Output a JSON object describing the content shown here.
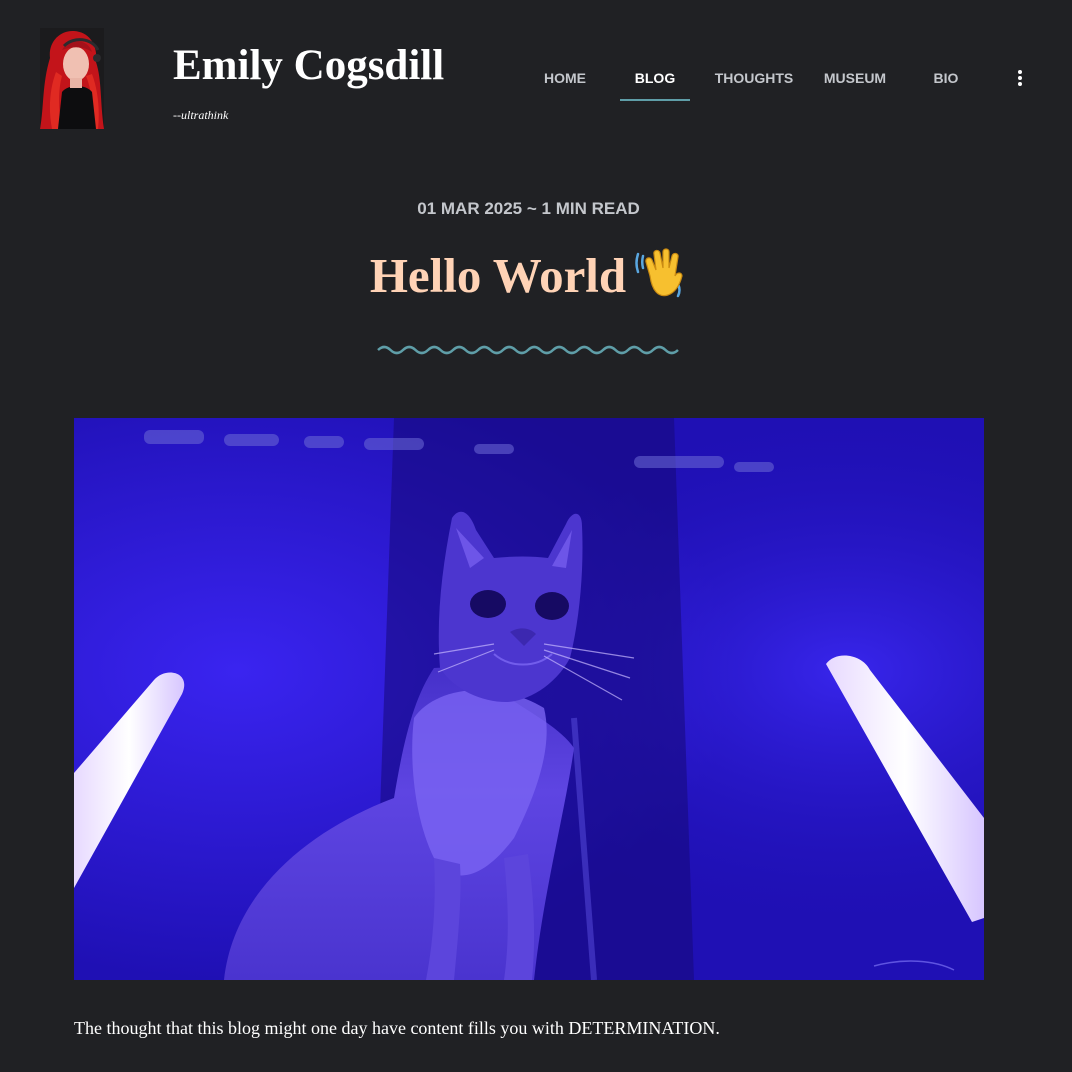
{
  "site": {
    "title": "Emily Cogsdill",
    "tagline": "--ultrathink"
  },
  "nav": {
    "items": [
      {
        "label": "HOME",
        "active": false
      },
      {
        "label": "BLOG",
        "active": true
      },
      {
        "label": "THOUGHTS",
        "active": false
      },
      {
        "label": "MUSEUM",
        "active": false
      },
      {
        "label": "BIO",
        "active": false
      }
    ],
    "more_icon": "kebab-menu-icon"
  },
  "post": {
    "meta": "01 MAR 2025 ~ 1 MIN READ",
    "title": "Hello World",
    "title_emoji": "waving-hand-emoji",
    "body": "The thought that this blog might one day have content fills you with DETERMINATION."
  },
  "colors": {
    "background": "#202124",
    "title_accent": "#ffd3b6",
    "nav_underline": "#5f9ea8",
    "squiggle": "#5f9ea8",
    "nav_text": "#c4c7cc",
    "image_blue": "#2a17c8"
  }
}
